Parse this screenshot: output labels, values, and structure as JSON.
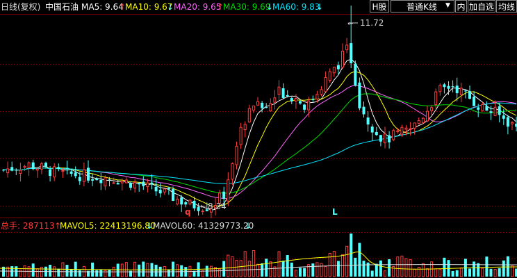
{
  "header": {
    "period_label": "日线(复权)",
    "stock_name": "中国石油",
    "ma": [
      {
        "label": "MA5: 9.64",
        "arrow": "↑",
        "color": "#ffffff"
      },
      {
        "label": "MA10: 9.67",
        "arrow": "↓",
        "color": "#ffff00"
      },
      {
        "label": "MA20: 9.65",
        "arrow": "↑",
        "color": "#ff66ff"
      },
      {
        "label": "MA30: 9.69",
        "arrow": "↓",
        "color": "#00dd00"
      },
      {
        "label": "MA60: 9.83",
        "arrow": "↓",
        "color": "#00e5ff"
      }
    ],
    "h_share_btn": "H股",
    "kline_select": "普通K线",
    "nei_btn": "内",
    "add_watch_btn": "加自选",
    "ma_line_btn": "均线"
  },
  "price_annotations": {
    "high": "11.72",
    "low": "8.34",
    "q_mark": "q",
    "l_mark": "L"
  },
  "volume": {
    "total_label": "总手: 287113",
    "total_arrow": "↑",
    "mavol5": "MAVOL5: 22413196.80",
    "mavol5_arrow": "↓",
    "mavol60": "MAVOL60: 41329773.20",
    "mavol60_arrow": "↓"
  },
  "colors": {
    "up": "#ff3c3c",
    "down": "#54ffff",
    "grid": "#7a0000",
    "ma5": "#ffffff",
    "ma10": "#ffff00",
    "ma20": "#ff66ff",
    "ma30": "#00dd00",
    "ma60": "#00e5ff"
  }
}
